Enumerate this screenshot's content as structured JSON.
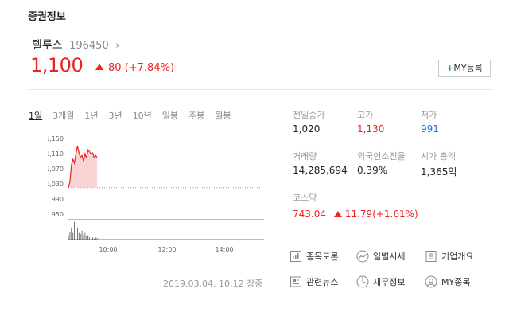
{
  "section_title": "증권정보",
  "stock": {
    "name": "텔루스",
    "code": "196450",
    "chevron": "›",
    "price": "1,100",
    "change": "80",
    "change_pct": "(+7.84%)"
  },
  "my_button": {
    "plus": "+",
    "label": "MY등록"
  },
  "tabs": [
    "1일",
    "3개월",
    "1년",
    "3년",
    "10년",
    "일봉",
    "주봉",
    "월봉"
  ],
  "chart_data": {
    "type": "line",
    "y_ticks": [
      "1,150",
      "1,110",
      "1,070",
      "1,030",
      "990",
      "950"
    ],
    "x_ticks": [
      "10:00",
      "12:00",
      "14:00"
    ],
    "reference": 1020,
    "y_range": [
      950,
      1150
    ],
    "prices": [
      1020,
      1035,
      1080,
      1095,
      1085,
      1110,
      1130,
      1112,
      1100,
      1105,
      1090,
      1110,
      1098,
      1120,
      1115,
      1108,
      1112,
      1100,
      1105,
      1100
    ],
    "volume": [
      0.2,
      0.35,
      0.55,
      0.3,
      0.8,
      1.0,
      0.5,
      0.3,
      0.25,
      0.4,
      0.2,
      0.3,
      0.15,
      0.2,
      0.1,
      0.15,
      0.1,
      0.05,
      0.1,
      0.08
    ]
  },
  "datetime": "2019.03.04. 10:12 장중",
  "info": {
    "prev_close_label": "전일종가",
    "prev_close": "1,020",
    "high_label": "고가",
    "high": "1,130",
    "low_label": "저가",
    "low": "991",
    "volume_label": "거래량",
    "volume": "14,285,694",
    "foreign_label": "외국인소진율",
    "foreign": "0.39%",
    "mcap_label": "시가 총액",
    "mcap": "1,365억"
  },
  "kosdaq": {
    "label": "코스닥",
    "value": "743.04",
    "change": "11.79",
    "change_pct": "(+1.61%)"
  },
  "links": [
    "종목토론",
    "일별시세",
    "기업개요",
    "관련뉴스",
    "재무정보",
    "MY종목"
  ],
  "colors": {
    "up": "#e22222",
    "down": "#2a6fd8"
  }
}
